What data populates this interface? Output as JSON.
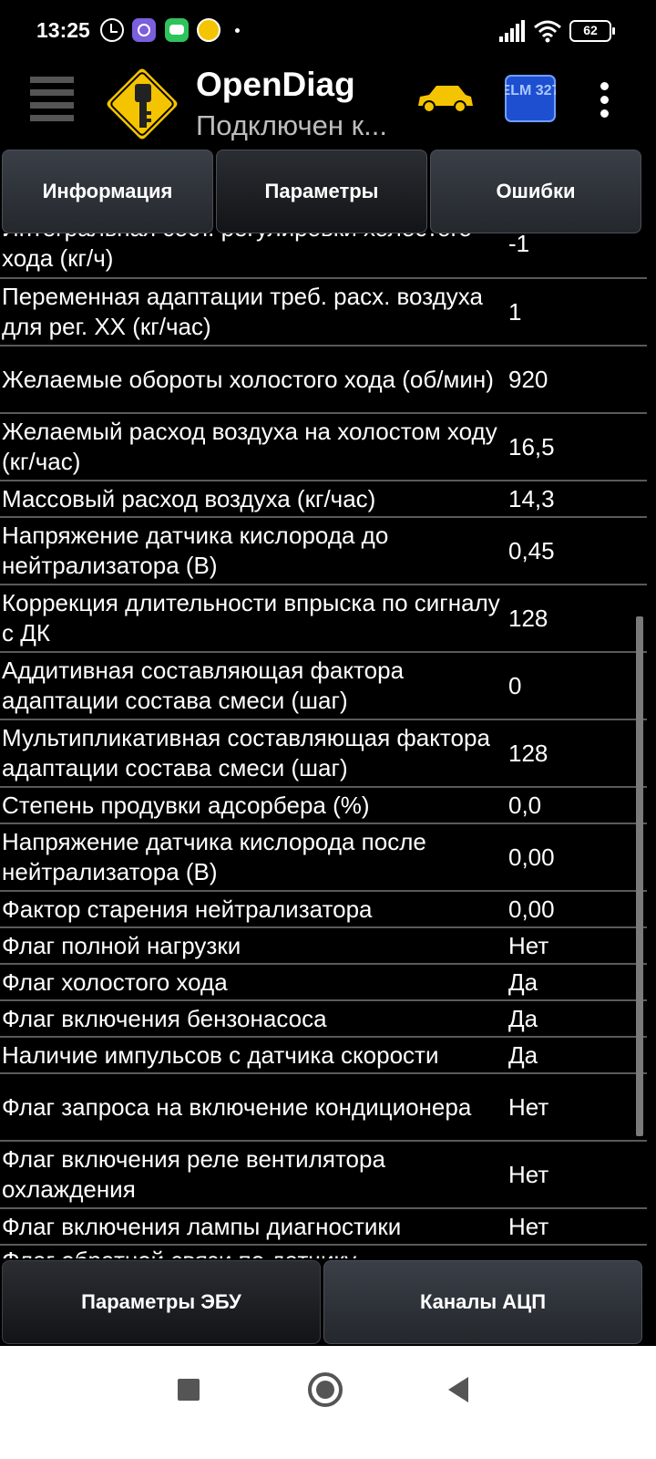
{
  "status_bar": {
    "time": "13:25",
    "battery": "62",
    "icons": [
      "alarm-icon",
      "viber-icon",
      "chat-icon",
      "opendiag-notification-icon",
      "signal-icon",
      "wifi-icon",
      "battery-icon"
    ]
  },
  "app_bar": {
    "title": "OpenDiag",
    "subtitle": "Подключен к..."
  },
  "tabs": [
    {
      "label": "Информация",
      "active": false
    },
    {
      "label": "Параметры",
      "active": true
    },
    {
      "label": "Ошибки",
      "active": false
    }
  ],
  "params": [
    {
      "name": "Интегральная сост. регулировки холостого хода (кг/ч)",
      "value": "-1"
    },
    {
      "name": "Переменная адаптации треб. расх. воздуха для рег. ХХ (кг/час)",
      "value": "1"
    },
    {
      "name": "Желаемые обороты холостого хода (об/мин)",
      "value": "920"
    },
    {
      "name": "Желаемый расход воздуха на холостом ходу (кг/час)",
      "value": "16,5"
    },
    {
      "name": "Массовый расход воздуха (кг/час)",
      "value": "14,3"
    },
    {
      "name": "Напряжение датчика кислорода до нейтрализатора (В)",
      "value": "0,45"
    },
    {
      "name": "Коррекция длительности впрыска по сигналу с ДК",
      "value": "128"
    },
    {
      "name": "Аддитивная составляющая фактора адаптации состава смеси (шаг)",
      "value": "0"
    },
    {
      "name": "Мультипликативная составляющая фактора адаптации состава смеси (шаг)",
      "value": "128"
    },
    {
      "name": "Степень продувки адсорбера (%)",
      "value": "0,0"
    },
    {
      "name": "Напряжение датчика кислорода после нейтрализатора (В)",
      "value": "0,00"
    },
    {
      "name": "Фактор старения нейтрализатора",
      "value": "0,00"
    },
    {
      "name": "Флаг полной нагрузки",
      "value": "Нет"
    },
    {
      "name": "Флаг холостого хода",
      "value": "Да"
    },
    {
      "name": "Флаг включения бензонасоса",
      "value": "Да"
    },
    {
      "name": "Наличие импульсов с датчика скорости",
      "value": "Да"
    },
    {
      "name": "Флаг запроса на включение кондиционера",
      "value": "Нет"
    },
    {
      "name": "Флаг включения реле вентилятора охлаждения",
      "value": "Нет"
    },
    {
      "name": "Флаг включения лампы диагностики",
      "value": "Нет"
    },
    {
      "name": "Флаг обратной связи по датчику",
      "value": ""
    }
  ],
  "bottom_tabs": [
    {
      "label": "Параметры ЭБУ",
      "active": true
    },
    {
      "label": "Каналы АЦП",
      "active": false
    }
  ],
  "elm_label": "ELM 327",
  "colors": {
    "background": "#000000",
    "accent_yellow": "#f5c400",
    "divider": "#5a5a5a",
    "subtitle": "#bdbdbd"
  }
}
